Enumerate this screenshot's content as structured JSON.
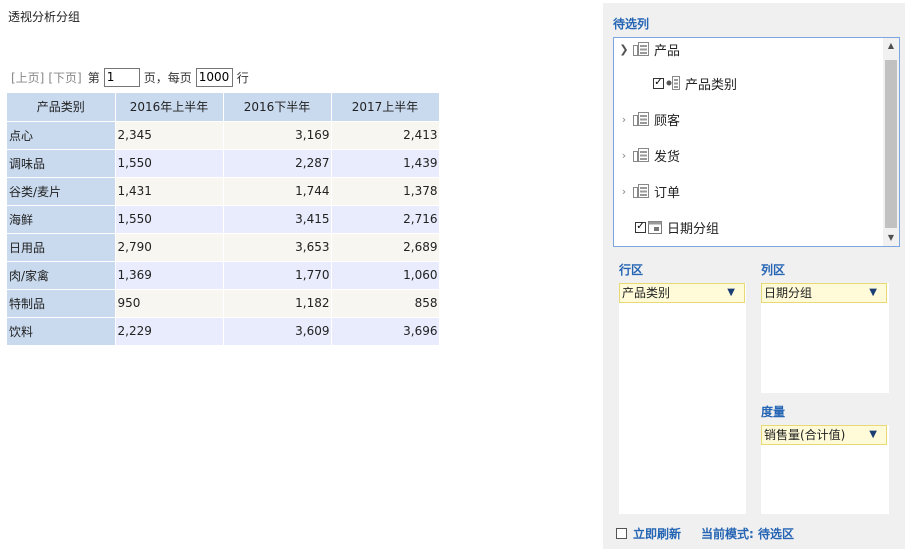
{
  "page_title": "透视分析分组",
  "pager": {
    "prev": "[上页]",
    "next": "[下页]",
    "page_prefix": "第",
    "page_value": "1",
    "page_suffix": "页，每页",
    "size_value": "1000",
    "size_suffix": "行"
  },
  "table": {
    "headers": [
      "产品类别",
      "2016年上半年",
      "2016下半年",
      "2017上半年"
    ],
    "rows": [
      [
        "点心",
        "2,345",
        "3,169",
        "2,413"
      ],
      [
        "调味品",
        "1,550",
        "2,287",
        "1,439"
      ],
      [
        "谷类/麦片",
        "1,431",
        "1,744",
        "1,378"
      ],
      [
        "海鲜",
        "1,550",
        "3,415",
        "2,716"
      ],
      [
        "日用品",
        "2,790",
        "3,653",
        "2,689"
      ],
      [
        "肉/家禽",
        "1,369",
        "1,770",
        "1,060"
      ],
      [
        "特制品",
        "950",
        "1,182",
        "858"
      ],
      [
        "饮料",
        "2,229",
        "3,609",
        "3,696"
      ]
    ]
  },
  "panel": {
    "candidate_label": "待选列",
    "tree": {
      "product": "产品",
      "product_category": "产品类别",
      "customer": "顾客",
      "shipping": "发货",
      "order": "订单",
      "date_group": "日期分组"
    },
    "row_zone_label": "行区",
    "col_zone_label": "列区",
    "measure_label": "度量",
    "row_field": "产品类别",
    "col_field": "日期分组",
    "measure_field": "销售量(合计值)",
    "refresh_label": "立即刷新",
    "mode_label": "当前模式: 待选区"
  },
  "colors": {
    "accent": "#2565b4",
    "header_bg": "#c9daef",
    "field_bg": "#fffbd8"
  },
  "icons": [
    "chevron-down-icon",
    "chevron-right-icon",
    "dimension-folder-icon",
    "field-icon",
    "date-folder-icon",
    "scroll-up-icon",
    "scroll-down-icon",
    "dropdown-arrow-icon"
  ]
}
